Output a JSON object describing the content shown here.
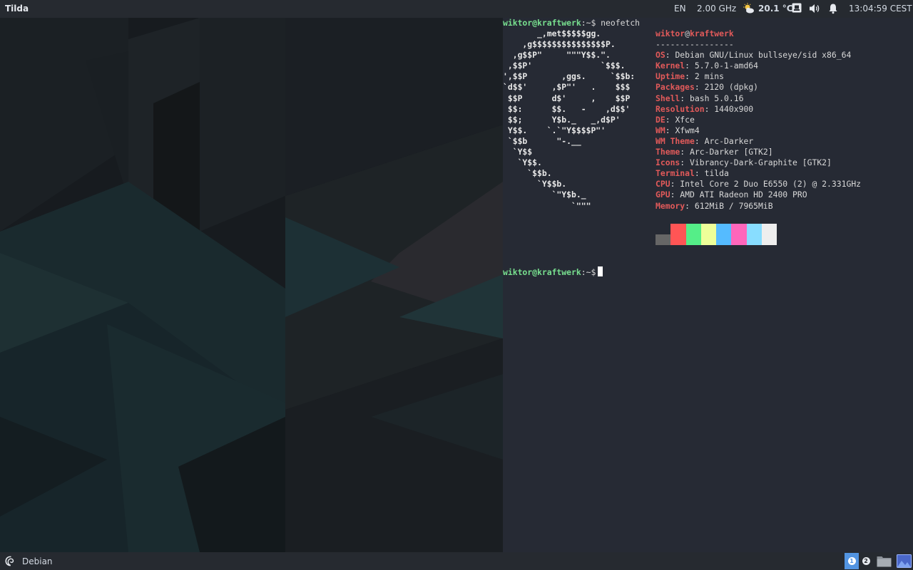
{
  "top_panel": {
    "app_title": "Tilda",
    "keyboard_layout": "EN",
    "cpu_freq": "2.00 GHz",
    "weather_temp": "20.1 °C",
    "clock": "13:04:59 CEST",
    "icons": [
      "weather-icon",
      "network-icon",
      "volume-icon",
      "notification-bell-icon"
    ]
  },
  "terminal": {
    "user": "wiktor@kraftwerk",
    "prompt_path": ":~$",
    "command": "neofetch",
    "ascii_logo": [
      "       _,met$$$$$gg.",
      "    ,g$$$$$$$$$$$$$$$P.",
      "  ,g$$P\"     \"\"\"Y$$.\".",
      " ,$$P'              `$$$.",
      "',$$P       ,ggs.     `$$b:",
      "`d$$'     ,$P\"'   .    $$$",
      " $$P      d$'     ,    $$P",
      " $$:      $$.   -    ,d$$'",
      " $$;      Y$b._   _,d$P'",
      " Y$$.    `.`\"Y$$$$P\"'",
      " `$$b      \"-.__",
      "  `Y$$",
      "   `Y$$.",
      "     `$$b.",
      "       `Y$$b.",
      "          `\"Y$b._",
      "              `\"\"\""
    ],
    "info_header": {
      "user": "wiktor",
      "at": "@",
      "host": "kraftwerk",
      "separator": "----------------"
    },
    "info": [
      {
        "key": "OS",
        "value": "Debian GNU/Linux bullseye/sid x86_64"
      },
      {
        "key": "Kernel",
        "value": "5.7.0-1-amd64"
      },
      {
        "key": "Uptime",
        "value": "2 mins"
      },
      {
        "key": "Packages",
        "value": "2120 (dpkg)"
      },
      {
        "key": "Shell",
        "value": "bash 5.0.16"
      },
      {
        "key": "Resolution",
        "value": "1440x900"
      },
      {
        "key": "DE",
        "value": "Xfce"
      },
      {
        "key": "WM",
        "value": "Xfwm4"
      },
      {
        "key": "WM Theme",
        "value": "Arc-Darker"
      },
      {
        "key": "Theme",
        "value": "Arc-Darker [GTK2]"
      },
      {
        "key": "Icons",
        "value": "Vibrancy-Dark-Graphite [GTK2]"
      },
      {
        "key": "Terminal",
        "value": "tilda"
      },
      {
        "key": "CPU",
        "value": "Intel Core 2 Duo E6550 (2) @ 2.331GHz"
      },
      {
        "key": "GPU",
        "value": "AMD ATI Radeon HD 2400 PRO"
      },
      {
        "key": "Memory",
        "value": "612MiB / 7965MiB"
      }
    ],
    "palette": [
      "#666666",
      "#ff5555",
      "#55ee88",
      "#eeff99",
      "#55bbff",
      "#ff66bb",
      "#88ddff",
      "#eeeeee"
    ]
  },
  "bottom_panel": {
    "menu_label": "Debian",
    "workspaces": [
      "1",
      "2"
    ],
    "active_workspace": "1"
  },
  "colors": {
    "panel_bg": "#262a30",
    "terminal_bg": "#262a34",
    "prompt_green": "#78e08f",
    "key_red": "#e25a5a",
    "workspace_accent": "#5294e2"
  }
}
